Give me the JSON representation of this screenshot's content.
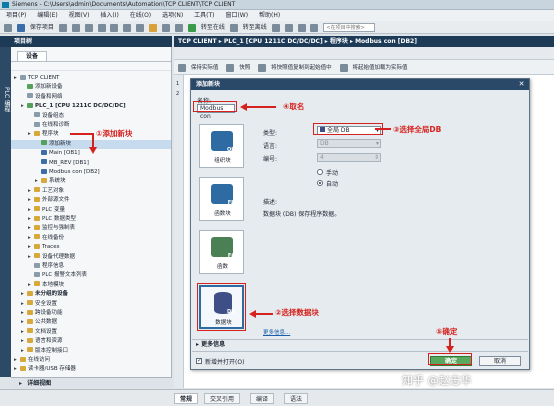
{
  "window": {
    "title": "Siemens - C:\\Users\\admin\\Documents\\Automation\\TCP CLIENT\\TCP CLIENT"
  },
  "menu": [
    "项目(P)",
    "编辑(E)",
    "视图(V)",
    "插入(I)",
    "在线(O)",
    "选项(N)",
    "工具(T)",
    "窗口(W)",
    "帮助(H)"
  ],
  "toolbar": {
    "save_label": "保存项目",
    "go_online": "转至在线",
    "go_offline": "转至离线",
    "search_placeholder": "<在项目中搜索>"
  },
  "project_tree": {
    "title": "项目树",
    "device_tab": "设备",
    "side_tab": "PLC 编程",
    "items": [
      {
        "label": "TCP CLIENT",
        "indent": 0,
        "icon": "project-icon"
      },
      {
        "label": "添加新设备",
        "indent": 1,
        "icon": "add-icon"
      },
      {
        "label": "设备和网络",
        "indent": 1,
        "icon": "network-icon"
      },
      {
        "label": "PLC_1 [CPU 1211C DC/DC/DC]",
        "indent": 1,
        "icon": "plc-icon",
        "bold": true
      },
      {
        "label": "设备组态",
        "indent": 2,
        "icon": "config-icon"
      },
      {
        "label": "在线和诊断",
        "indent": 2,
        "icon": "diag-icon"
      },
      {
        "label": "程序块",
        "indent": 2,
        "icon": "folder-icon"
      },
      {
        "label": "添加新块",
        "indent": 3,
        "icon": "add-icon",
        "selected": true
      },
      {
        "label": "Main [OB1]",
        "indent": 3,
        "icon": "ob-icon"
      },
      {
        "label": "MB_REV [DB1]",
        "indent": 3,
        "icon": "db-icon"
      },
      {
        "label": "Modbus con [DB2]",
        "indent": 3,
        "icon": "db-icon"
      },
      {
        "label": "系统块",
        "indent": 3,
        "icon": "folder-icon"
      },
      {
        "label": "工艺对象",
        "indent": 2,
        "icon": "folder-icon"
      },
      {
        "label": "外部源文件",
        "indent": 2,
        "icon": "folder-icon"
      },
      {
        "label": "PLC 变量",
        "indent": 2,
        "icon": "folder-icon"
      },
      {
        "label": "PLC 数据类型",
        "indent": 2,
        "icon": "folder-icon"
      },
      {
        "label": "监控与强制表",
        "indent": 2,
        "icon": "folder-icon"
      },
      {
        "label": "在线备份",
        "indent": 2,
        "icon": "folder-icon"
      },
      {
        "label": "Traces",
        "indent": 2,
        "icon": "folder-icon"
      },
      {
        "label": "设备代理数据",
        "indent": 2,
        "icon": "folder-icon"
      },
      {
        "label": "程序信息",
        "indent": 2,
        "icon": "info-icon"
      },
      {
        "label": "PLC 报警文本列表",
        "indent": 2,
        "icon": "list-icon"
      },
      {
        "label": "本地模块",
        "indent": 2,
        "icon": "folder-icon"
      },
      {
        "label": "未分组的设备",
        "indent": 1,
        "icon": "folder-icon",
        "bold": true
      },
      {
        "label": "安全设置",
        "indent": 1,
        "icon": "folder-icon"
      },
      {
        "label": "跨设备功能",
        "indent": 1,
        "icon": "folder-icon"
      },
      {
        "label": "公共数据",
        "indent": 1,
        "icon": "folder-icon"
      },
      {
        "label": "文档设置",
        "indent": 1,
        "icon": "folder-icon"
      },
      {
        "label": "语言和资源",
        "indent": 1,
        "icon": "folder-icon"
      },
      {
        "label": "版本控制接口",
        "indent": 1,
        "icon": "folder-icon"
      },
      {
        "label": "在线访问",
        "indent": 0,
        "icon": "folder-icon"
      },
      {
        "label": "读卡器/USB 存储器",
        "indent": 0,
        "icon": "folder-icon"
      }
    ],
    "details_view": "详细视图"
  },
  "editor": {
    "breadcrumb": "TCP CLIENT ▸ PLC_1 [CPU 1211C DC/DC/DC] ▸ 程序块 ▸ Modbus con [DB2]",
    "toolbar_items": [
      "保持实际值",
      "快照",
      "将快照值复制到起始值中",
      "将起始值加载为实际值"
    ],
    "row_numbers": [
      "1",
      "2"
    ]
  },
  "dialog": {
    "title": "添加新块",
    "name_label": "名称:",
    "name_value": "Modbus con",
    "blocks": [
      {
        "code": "OB",
        "label": "组织块"
      },
      {
        "code": "FB",
        "label": "函数块"
      },
      {
        "code": "FC",
        "label": "函数"
      },
      {
        "code": "DB",
        "label": "数据块"
      }
    ],
    "type_label": "类型:",
    "type_value": "全局 DB",
    "language_label": "语言:",
    "language_value": "DB",
    "number_label": "编号:",
    "number_value": "4",
    "manual_label": "手动",
    "auto_label": "自动",
    "description_label": "描述:",
    "description_text": "数据块 (DB) 保存程序数据。",
    "more_info_link": "更多信息...",
    "more_info_section": "更多信息",
    "add_open_label": "新增并打开(O)",
    "ok_label": "确定",
    "cancel_label": "取消"
  },
  "annotations": {
    "step1": "①添加新块",
    "step2": "②选择数据块",
    "step3": "③选择全局DB",
    "step4": "④取名",
    "step5": "⑤确定"
  },
  "status_tabs": [
    "常规",
    "交叉引用",
    "编译",
    "语法"
  ],
  "watermark": "知乎 @赵志华",
  "colors": {
    "accent": "#1d3a57",
    "annotation": "#d6221e",
    "ok": "#5aa85e"
  }
}
